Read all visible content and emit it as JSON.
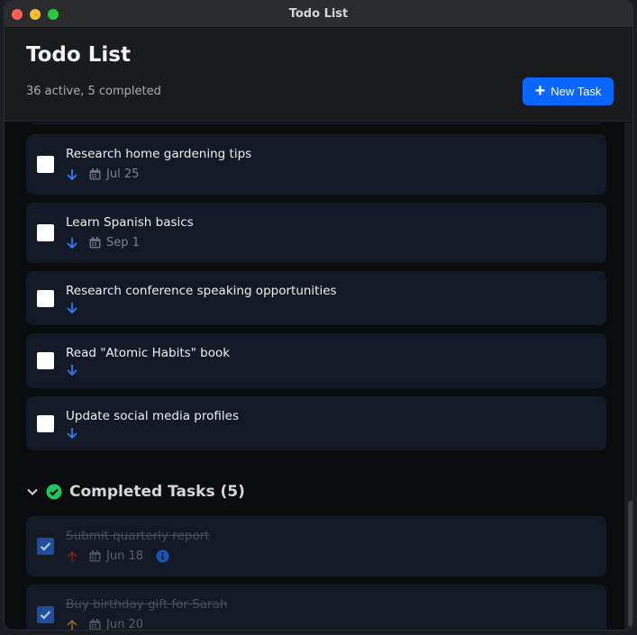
{
  "window": {
    "title": "Todo List"
  },
  "header": {
    "title": "Todo List",
    "summary": "36 active, 5 completed",
    "new_task_label": "New Task"
  },
  "active_tasks": [
    {
      "title": "Research home gardening tips",
      "priority": "low",
      "date": "Jul 25"
    },
    {
      "title": "Learn Spanish basics",
      "priority": "low",
      "date": "Sep 1"
    },
    {
      "title": "Research conference speaking opportunities",
      "priority": "low",
      "date": ""
    },
    {
      "title": "Read \"Atomic Habits\" book",
      "priority": "low",
      "date": ""
    },
    {
      "title": "Update social media profiles",
      "priority": "low",
      "date": ""
    }
  ],
  "completed_section": {
    "title": "Completed Tasks (5)"
  },
  "completed_tasks": [
    {
      "title": "Submit quarterly report",
      "priority": "high",
      "date": "Jun 18",
      "has_info": true
    },
    {
      "title": "Buy birthday gift for Sarah",
      "priority": "medium",
      "date": "Jun 20",
      "has_info": false
    }
  ],
  "colors": {
    "accent": "#0a66ff",
    "priority_low": "#2f7cf6",
    "priority_high": "#c0392b",
    "priority_medium": "#c98a1a",
    "completed_check": "#22c55e"
  }
}
